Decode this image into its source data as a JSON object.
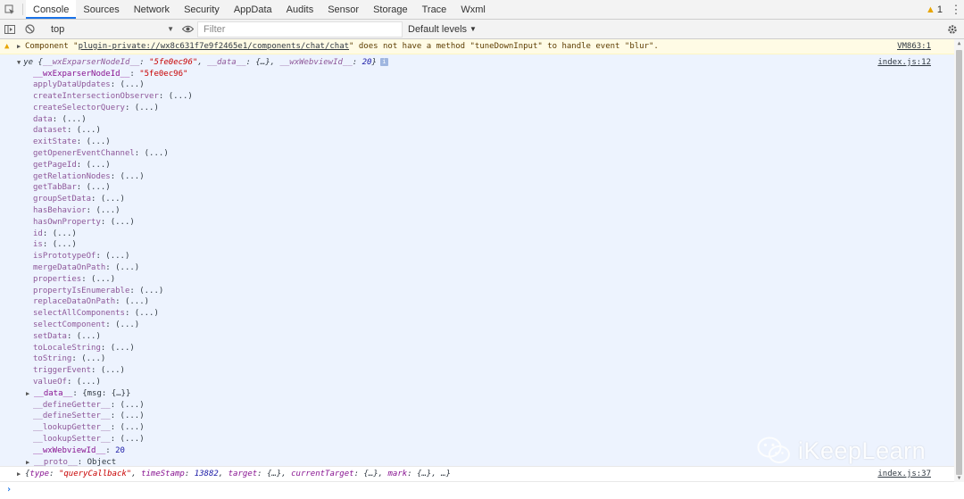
{
  "tabs": [
    {
      "label": "Console",
      "active": true
    },
    {
      "label": "Sources",
      "active": false
    },
    {
      "label": "Network",
      "active": false
    },
    {
      "label": "Security",
      "active": false
    },
    {
      "label": "AppData",
      "active": false
    },
    {
      "label": "Audits",
      "active": false
    },
    {
      "label": "Sensor",
      "active": false
    },
    {
      "label": "Storage",
      "active": false
    },
    {
      "label": "Trace",
      "active": false
    },
    {
      "label": "Wxml",
      "active": false
    }
  ],
  "header": {
    "warning_count": "1"
  },
  "toolbar": {
    "context": "top",
    "filter_placeholder": "Filter",
    "levels_label": "Default levels"
  },
  "warning": {
    "prefix": "Component \"",
    "link": "plugin-private://wx8c631f7e9f2465e1/components/chat/chat",
    "suffix": "\" does not have a method \"tuneDownInput\" to handle event \"blur\".",
    "source": "VM863:1"
  },
  "object": {
    "head_name": "ye",
    "head_k1": "__wxExparserNodeId__",
    "head_v1": "\"5fe0ec96\"",
    "head_k2": "__data__",
    "head_v2": "{…}",
    "head_k3": "__wxWebviewId__",
    "head_v3": "20",
    "info_badge": "i",
    "source": "index.js:12",
    "node_id_key": "__wxExparserNodeId__",
    "node_id_val": "\"5fe0ec96\"",
    "lazy": "(...)",
    "methods": [
      "applyDataUpdates",
      "createIntersectionObserver",
      "createSelectorQuery",
      "data",
      "dataset",
      "exitState",
      "getOpenerEventChannel",
      "getPageId",
      "getRelationNodes",
      "getTabBar",
      "groupSetData",
      "hasBehavior",
      "hasOwnProperty",
      "id",
      "is",
      "isPrototypeOf",
      "mergeDataOnPath",
      "properties",
      "propertyIsEnumerable",
      "replaceDataOnPath",
      "selectAllComponents",
      "selectComponent",
      "setData",
      "toLocaleString",
      "toString",
      "triggerEvent",
      "valueOf"
    ],
    "data_key": "__data__",
    "data_preview": "{msg: {…}}",
    "accessors": [
      "__defineGetter__",
      "__defineSetter__",
      "__lookupGetter__",
      "__lookupSetter__"
    ],
    "webview_key": "__wxWebviewId__",
    "webview_val": "20",
    "proto_key": "__proto__",
    "proto_val": "Object"
  },
  "event": {
    "k_type": "type",
    "v_type": "\"queryCallback\"",
    "k_ts": "timeStamp",
    "v_ts": "13882",
    "k_target": "target",
    "v_target": "{…}",
    "k_ct": "currentTarget",
    "v_ct": "{…}",
    "k_mark": "mark",
    "v_mark": "{…}",
    "ellipsis": "…",
    "source": "index.js:37"
  },
  "prompt": "›",
  "watermark": "iKeepLearn",
  "colors": {
    "accent": "#1a73e8",
    "warning_bg": "#fffbe5",
    "selected_bg": "#edf3fe",
    "key": "#881391",
    "string": "#c80000",
    "number": "#1a1aa6"
  }
}
